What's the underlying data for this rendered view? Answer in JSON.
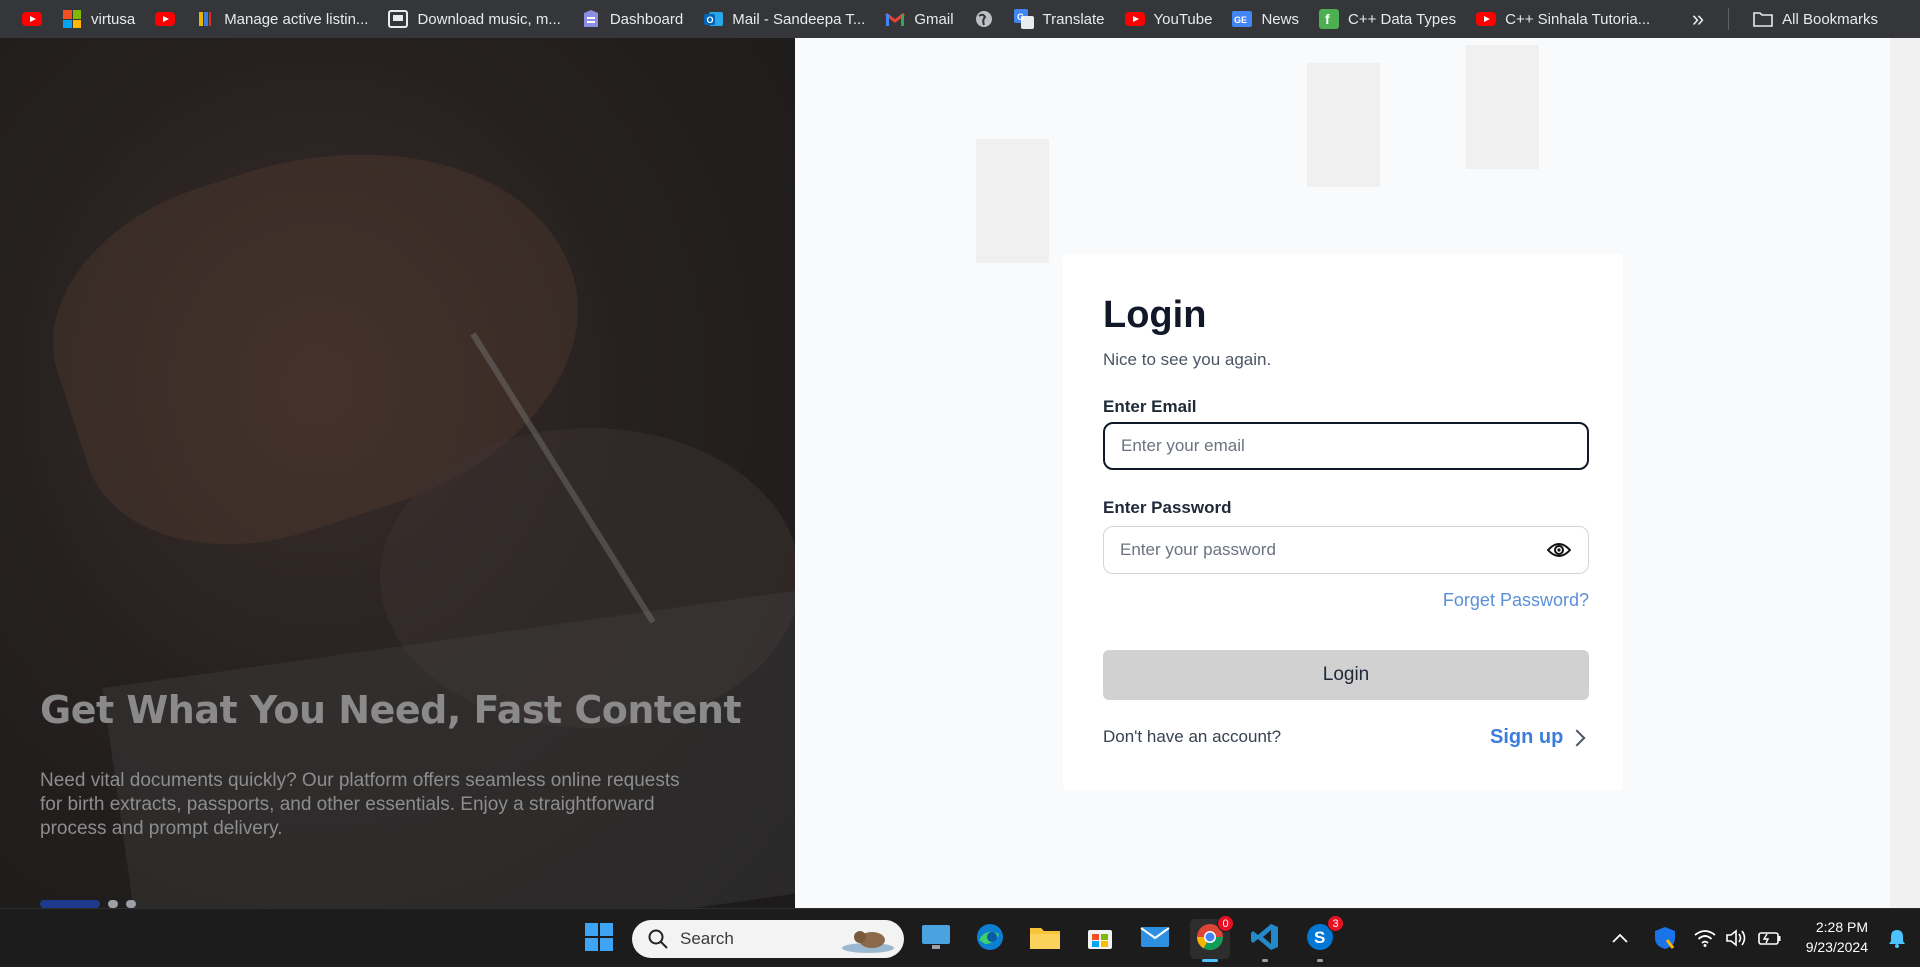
{
  "bookmarks": {
    "items": [
      {
        "label": "",
        "icon": "youtube-icon"
      },
      {
        "label": "virtusa",
        "icon": "microsoft-icon"
      },
      {
        "label": "",
        "icon": "youtube-icon"
      },
      {
        "label": "Manage active listin...",
        "icon": "listing-icon"
      },
      {
        "label": "Download music, m...",
        "icon": "download-icon"
      },
      {
        "label": "Dashboard",
        "icon": "dashboard-icon"
      },
      {
        "label": "Mail - Sandeepa T...",
        "icon": "outlook-icon"
      },
      {
        "label": "Gmail",
        "icon": "gmail-icon"
      },
      {
        "label": "",
        "icon": "globe-icon"
      },
      {
        "label": "Translate",
        "icon": "translate-icon"
      },
      {
        "label": "YouTube",
        "icon": "youtube-icon"
      },
      {
        "label": "News",
        "icon": "news-icon"
      },
      {
        "label": "C++ Data Types",
        "icon": "cpp-icon"
      },
      {
        "label": "C++ Sinhala Tutoria...",
        "icon": "youtube-icon"
      }
    ],
    "all_bookmarks": "All Bookmarks",
    "overflow": "»"
  },
  "hero": {
    "title": "Get What You Need, Fast Content",
    "text": "Need vital documents quickly? Our platform offers seamless online requests for birth extracts, passports, and other essentials. Enjoy a straightforward process and prompt delivery."
  },
  "login": {
    "title": "Login",
    "subtitle": "Nice to see you again.",
    "email_label": "Enter Email",
    "email_placeholder": "Enter your email",
    "password_label": "Enter Password",
    "password_placeholder": "Enter your password",
    "forgot": "Forget Password?",
    "button": "Login",
    "no_account": "Don't have an account?",
    "signup": "Sign up"
  },
  "taskbar": {
    "search_placeholder": "Search",
    "chrome_badge": "0",
    "skype_badge": "3",
    "time": "2:28 PM",
    "date": "9/23/2024"
  },
  "colors": {
    "accent": "#3b7ddd",
    "link": "#5b8fd9",
    "button_bg": "#d1d1d1",
    "hero_text": "#8a8a8a"
  }
}
